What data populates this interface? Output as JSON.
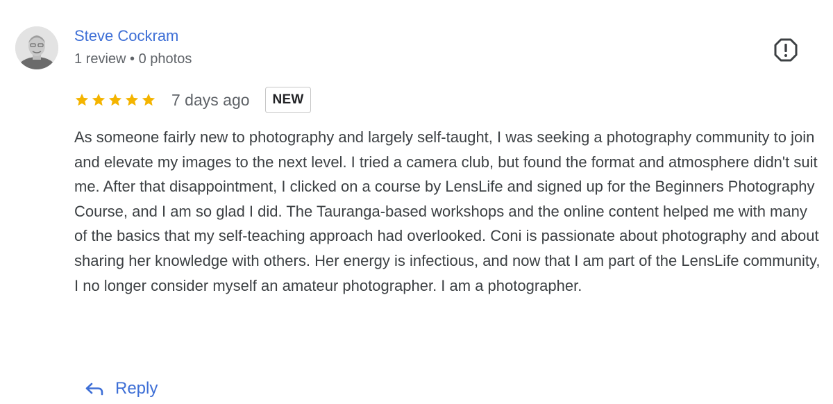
{
  "reviewer": {
    "name": "Steve Cockram",
    "meta": "1 review • 0 photos",
    "avatar_icon": "person-avatar"
  },
  "rating": {
    "stars": 5,
    "max_stars": 5,
    "star_color": "#f4b400"
  },
  "review": {
    "date": "7 days ago",
    "badge": "NEW",
    "text": "As someone fairly new to photography and largely self-taught, I was seeking a photography community to join and elevate my images to the next level. I tried a camera club, but found the format and atmosphere didn't suit me. After that disappointment, I clicked on a course by LensLife and signed up for the Beginners Photography Course, and I am so glad I did. The Tauranga-based workshops and the online content helped me with many of the basics that my self-teaching approach had overlooked. Coni is passionate about photography and about sharing her knowledge with others. Her energy is infectious, and now that I am part of the LensLife community, I no longer consider myself an amateur photographer. I am a photographer."
  },
  "actions": {
    "reply_label": "Reply",
    "reply_icon": "reply-arrow-icon",
    "report_icon": "report-icon"
  },
  "colors": {
    "link_blue": "#3e6fd6",
    "text": "#3c4043",
    "muted": "#5f6368"
  }
}
